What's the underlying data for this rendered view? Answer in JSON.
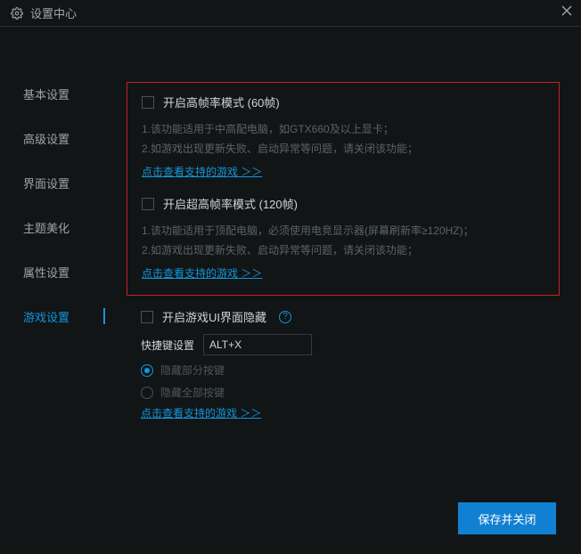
{
  "title": "设置中心",
  "sidebar": {
    "items": [
      {
        "label": "基本设置"
      },
      {
        "label": "高级设置"
      },
      {
        "label": "界面设置"
      },
      {
        "label": "主题美化"
      },
      {
        "label": "属性设置"
      },
      {
        "label": "游戏设置",
        "active": true
      }
    ]
  },
  "fps60": {
    "label": "开启高帧率模式 (60帧)",
    "desc1": "1.该功能适用于中高配电脑，如GTX660及以上显卡；",
    "desc2": "2.如游戏出现更新失败、启动异常等问题，请关闭该功能；",
    "link": "点击查看支持的游戏 ＞＞"
  },
  "fps120": {
    "label": "开启超高帧率模式 (120帧)",
    "desc1": "1.该功能适用于顶配电脑，必须使用电竞显示器(屏幕刷新率≥120HZ)；",
    "desc2": "2.如游戏出现更新失败、启动异常等问题，请关闭该功能；",
    "link": "点击查看支持的游戏 ＞＞"
  },
  "hideUI": {
    "label": "开启游戏UI界面隐藏",
    "hotkey_label": "快捷键设置",
    "hotkey_value": "ALT+X",
    "radio1": "隐藏部分按键",
    "radio2": "隐藏全部按键",
    "link": "点击查看支持的游戏 ＞＞"
  },
  "save": "保存并关闭"
}
